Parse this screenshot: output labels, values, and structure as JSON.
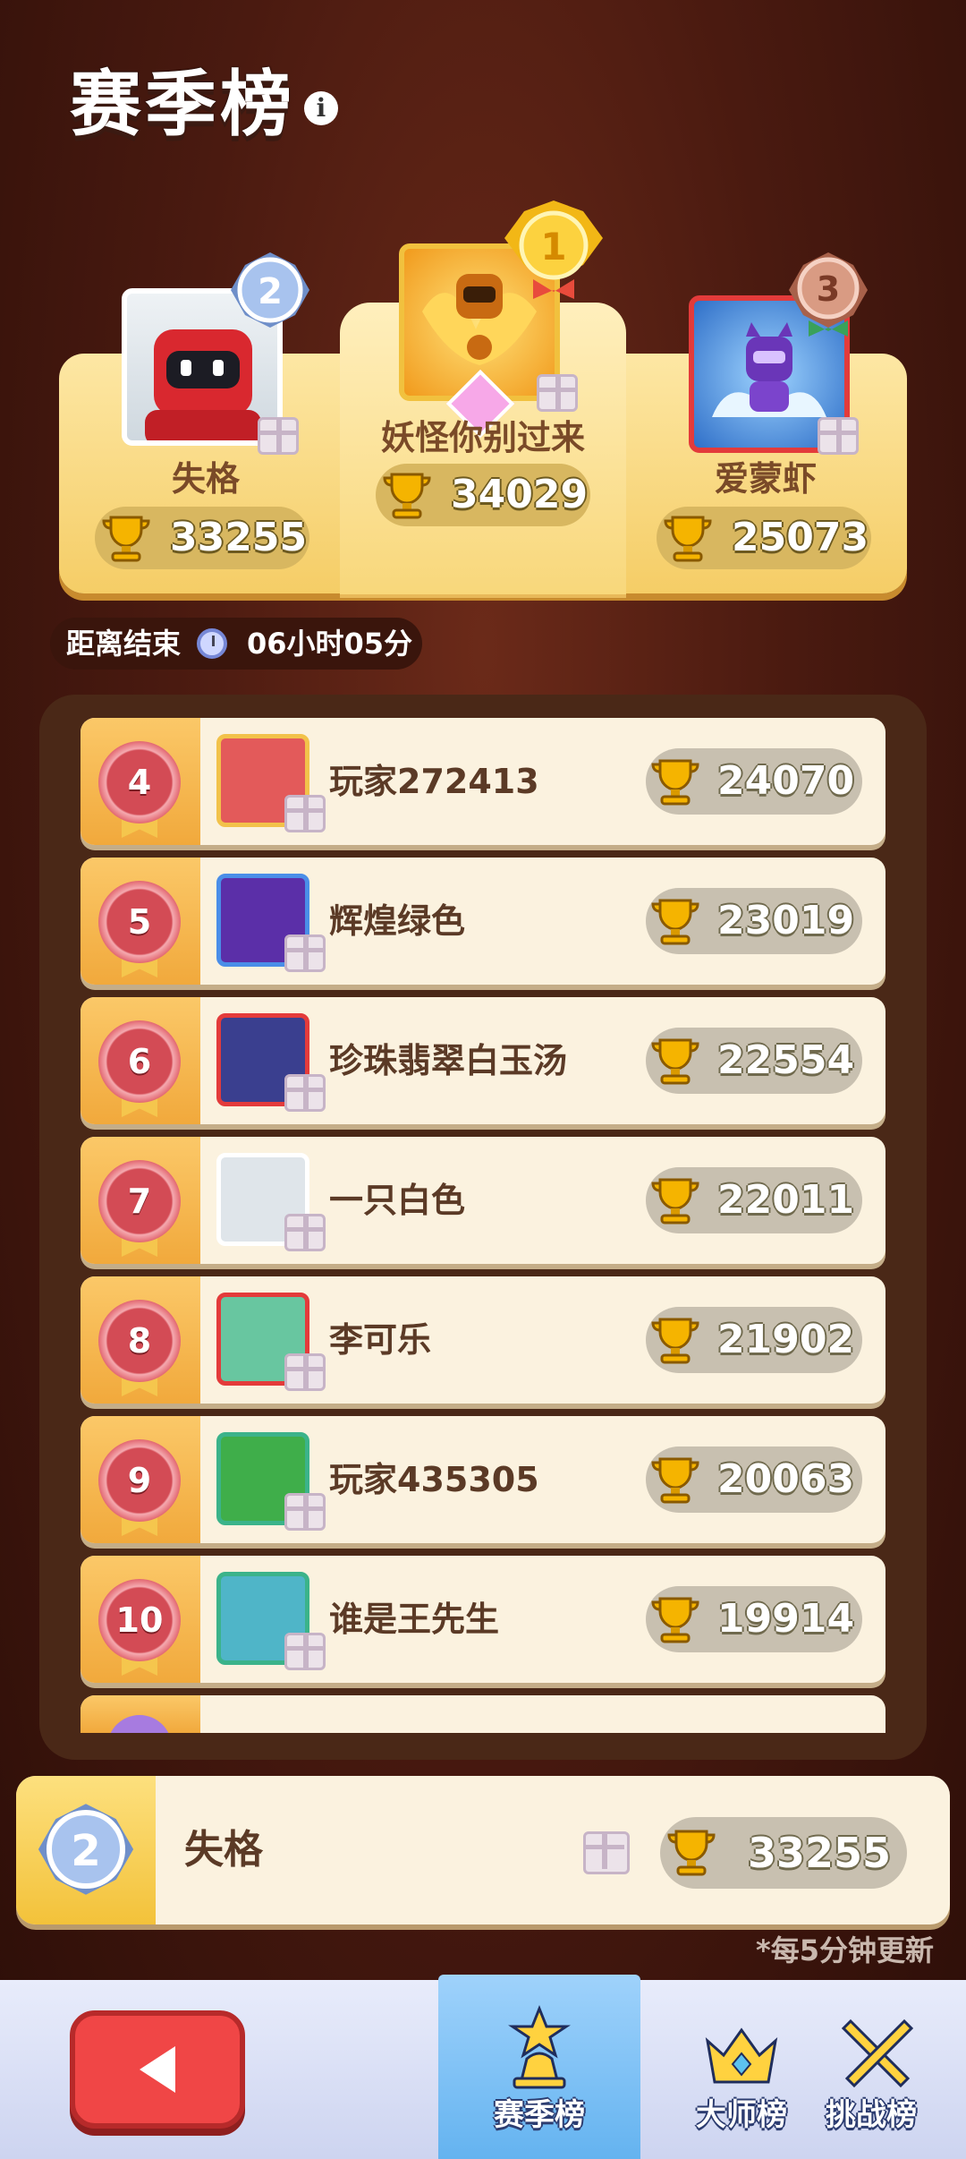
{
  "header": {
    "title": "赛季榜",
    "info_icon": "info-icon"
  },
  "podium": [
    {
      "rank": 2,
      "name": "失格",
      "score": "33255"
    },
    {
      "rank": 1,
      "name": "妖怪你别过来",
      "score": "34029"
    },
    {
      "rank": 3,
      "name": "爱蒙虾",
      "score": "25073"
    }
  ],
  "countdown": {
    "label": "距离结束",
    "time": "06小时05分"
  },
  "list": [
    {
      "rank": "4",
      "name": "玩家272413",
      "score": "24070"
    },
    {
      "rank": "5",
      "name": "辉煌绿色",
      "score": "23019"
    },
    {
      "rank": "6",
      "name": "珍珠翡翠白玉汤",
      "score": "22554"
    },
    {
      "rank": "7",
      "name": "一只白色",
      "score": "22011"
    },
    {
      "rank": "8",
      "name": "李可乐",
      "score": "21902"
    },
    {
      "rank": "9",
      "name": "玩家435305",
      "score": "20063"
    },
    {
      "rank": "10",
      "name": "谁是王先生",
      "score": "19914"
    }
  ],
  "my_entry": {
    "rank": "2",
    "name": "失格",
    "score": "33255"
  },
  "update_note": "*每5分钟更新",
  "tabs": [
    {
      "label": "赛季榜",
      "active": true
    },
    {
      "label": "大师榜",
      "active": false
    },
    {
      "label": "挑战榜",
      "active": false
    }
  ],
  "colors": {
    "accent": "#f5c64d",
    "back_button": "#f04646",
    "active_tab": "#64b3f0"
  }
}
